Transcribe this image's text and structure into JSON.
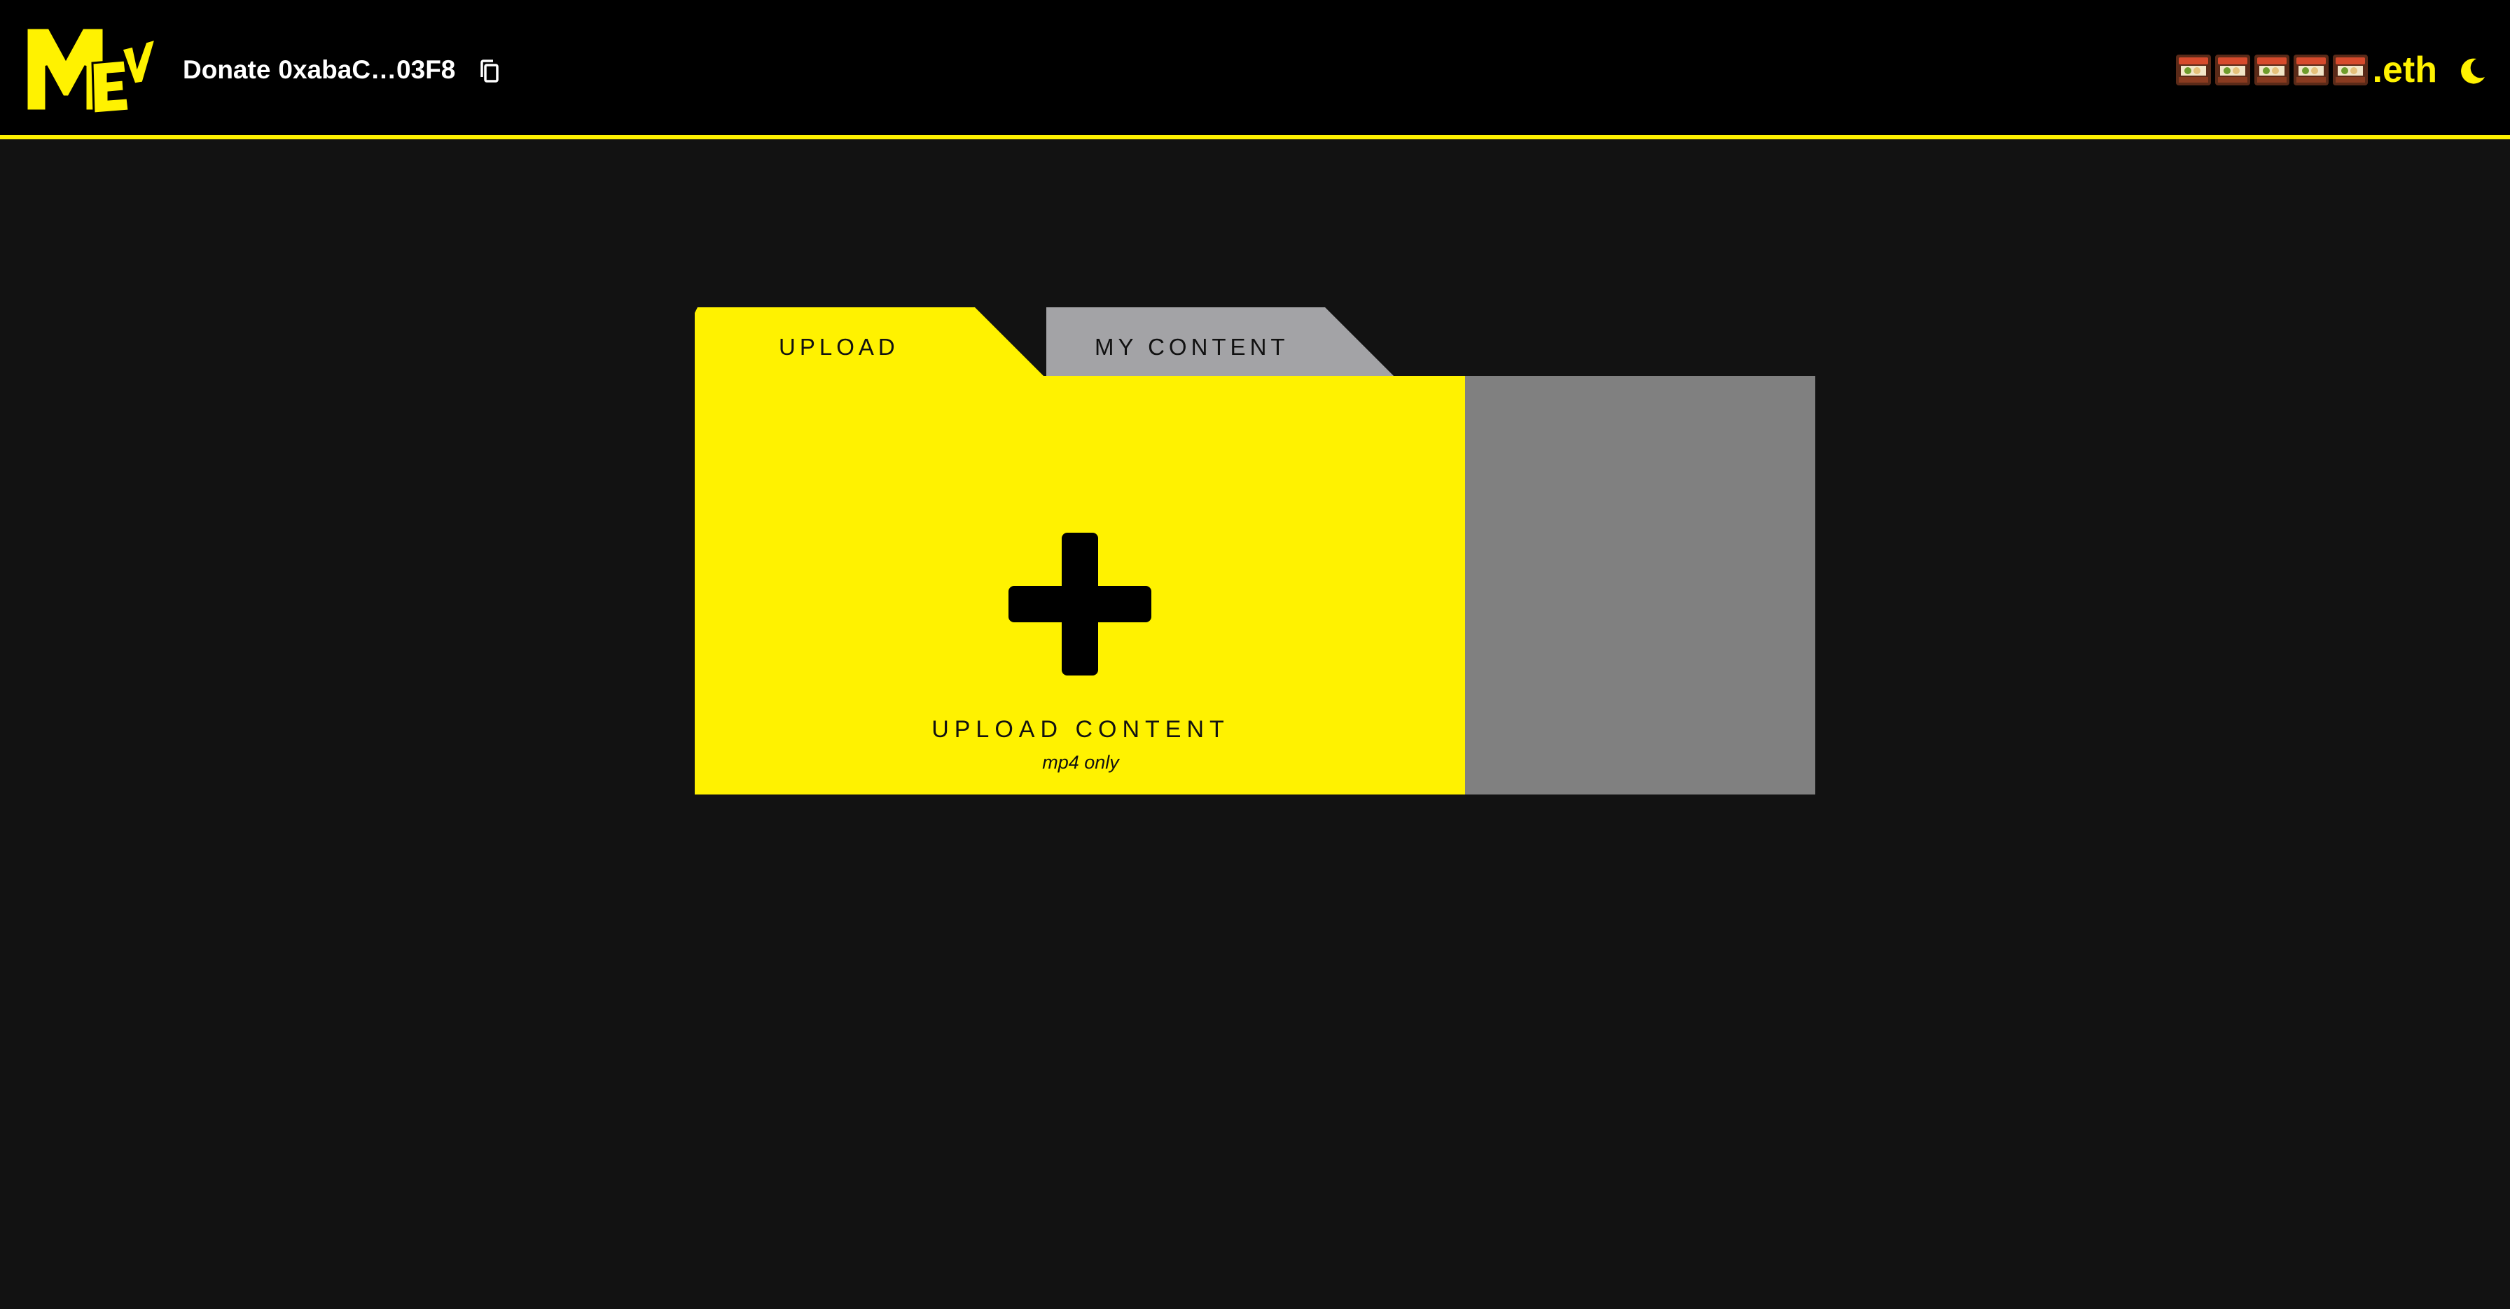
{
  "colors": {
    "accent": "#FFF200",
    "header_bg": "#000000",
    "page_bg": "#121212",
    "tab_inactive": "#A3A3A6",
    "side_panel": "#808080",
    "text_dark": "#111111"
  },
  "header": {
    "logo_icon": "mev-logo-icon",
    "donate_label": "Donate",
    "donate_address": "0xabaC…03F8",
    "copy_icon": "copy-icon",
    "ens": {
      "emoji_count": 5,
      "emoji_icon": "food-stall-emoji-icon",
      "suffix": ".eth"
    },
    "theme_icon": "moon-icon"
  },
  "folder": {
    "tabs": [
      {
        "label": "UPLOAD",
        "active": true
      },
      {
        "label": "MY CONTENT",
        "active": false
      }
    ],
    "upload": {
      "icon": "plus-icon",
      "title": "UPLOAD CONTENT",
      "subtitle": "mp4 only"
    }
  }
}
